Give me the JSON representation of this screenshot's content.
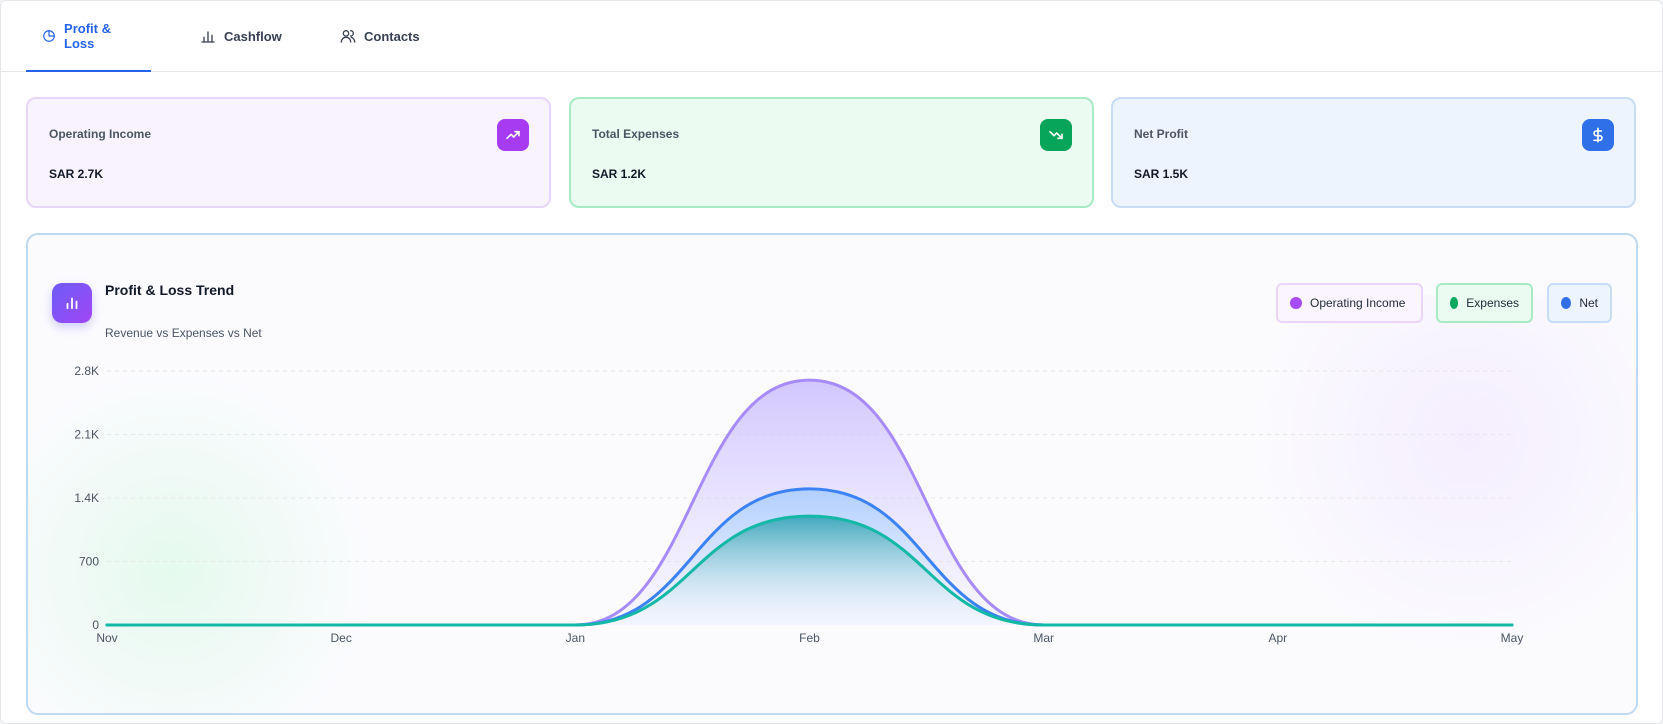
{
  "tabs": [
    {
      "label": "Profit & Loss",
      "icon": "pie-chart-icon",
      "active": true
    },
    {
      "label": "Cashflow",
      "icon": "bar-chart-icon",
      "active": false
    },
    {
      "label": "Contacts",
      "icon": "users-icon",
      "active": false
    }
  ],
  "kpis": {
    "income": {
      "label": "Operating Income",
      "value": "SAR 2.7K",
      "icon": "trending-up-icon",
      "color": "#a63bf2"
    },
    "expenses": {
      "label": "Total Expenses",
      "value": "SAR 1.2K",
      "icon": "trending-down-icon",
      "color": "#07a55a"
    },
    "net": {
      "label": "Net Profit",
      "value": "SAR 1.5K",
      "icon": "dollar-icon",
      "color": "#2f6fe8"
    }
  },
  "chart_card": {
    "title": "Profit & Loss Trend",
    "subtitle": "Revenue vs Expenses vs Net",
    "icon": "bar-chart-icon"
  },
  "legend": [
    {
      "label": "Operating Income",
      "color": "#a74bf5"
    },
    {
      "label": "Expenses",
      "color": "#0aa85e"
    },
    {
      "label": "Net",
      "color": "#2f6fe8"
    }
  ],
  "chart_data": {
    "type": "area",
    "categories": [
      "Nov",
      "Dec",
      "Jan",
      "Feb",
      "Mar",
      "Apr",
      "May"
    ],
    "ylim": [
      0,
      2800
    ],
    "yticks": [
      0,
      700,
      1400,
      2100,
      2800
    ],
    "ytick_labels": [
      "0",
      "700",
      "1.4K",
      "2.1K",
      "2.8K"
    ],
    "grid": true,
    "legend_position": "top-right",
    "series": [
      {
        "name": "Operating Income",
        "values": [
          0,
          0,
          0,
          2700,
          0,
          0,
          0
        ],
        "color": "#a78bfa"
      },
      {
        "name": "Net",
        "values": [
          0,
          0,
          0,
          1500,
          0,
          0,
          0
        ],
        "color": "#3b82f6"
      },
      {
        "name": "Expenses",
        "values": [
          0,
          0,
          0,
          1200,
          0,
          0,
          0
        ],
        "color": "#14b8a6"
      }
    ]
  }
}
